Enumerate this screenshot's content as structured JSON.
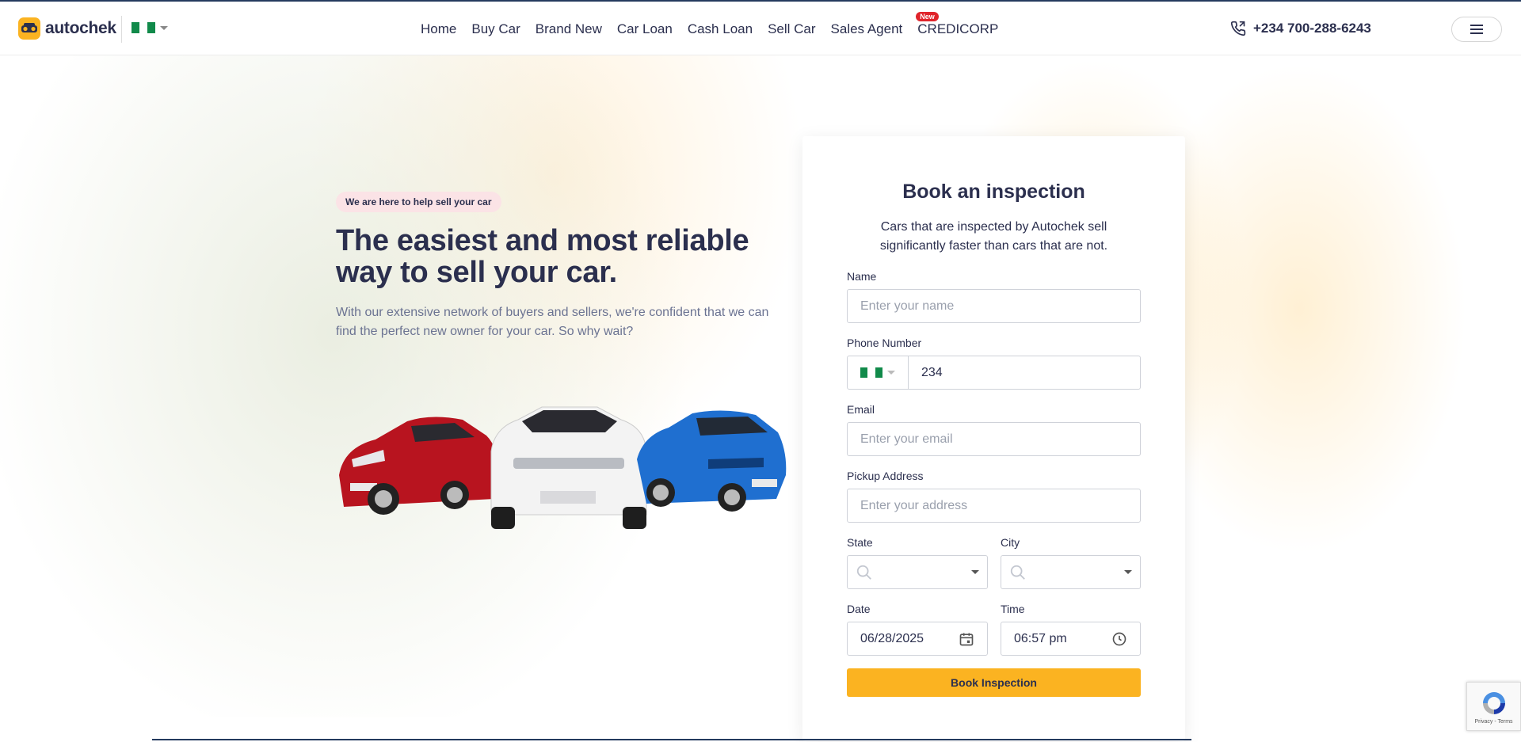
{
  "header": {
    "brand": "autochek",
    "nav": [
      "Home",
      "Buy Car",
      "Brand New",
      "Car Loan",
      "Cash Loan",
      "Sell Car",
      "Sales Agent",
      "CREDICORP"
    ],
    "new_badge": "New",
    "phone": "+234 700-288-6243"
  },
  "hero": {
    "tagline": "We are here to help sell your car",
    "headline": "The easiest and most reliable way to sell your car.",
    "subtext": "With our extensive network of buyers and sellers, we're confident that we can find the perfect new owner for your car. So why wait?"
  },
  "form": {
    "title": "Book an inspection",
    "subtitle": "Cars that are inspected by Autochek sell significantly faster than cars that are not.",
    "name_label": "Name",
    "name_placeholder": "Enter your name",
    "phone_label": "Phone Number",
    "phone_value": "234",
    "email_label": "Email",
    "email_placeholder": "Enter your email",
    "address_label": "Pickup Address",
    "address_placeholder": "Enter your address",
    "state_label": "State",
    "city_label": "City",
    "date_label": "Date",
    "date_value": "06/28/2025",
    "time_label": "Time",
    "time_value": "06:57 pm",
    "submit_label": "Book Inspection"
  },
  "recaptcha": {
    "links": "Privacy - Terms"
  },
  "colors": {
    "brand_yellow": "#fbb321",
    "text_dark": "#2b2f4e",
    "flag_green": "#118a4a",
    "badge_red": "#e0242b"
  }
}
